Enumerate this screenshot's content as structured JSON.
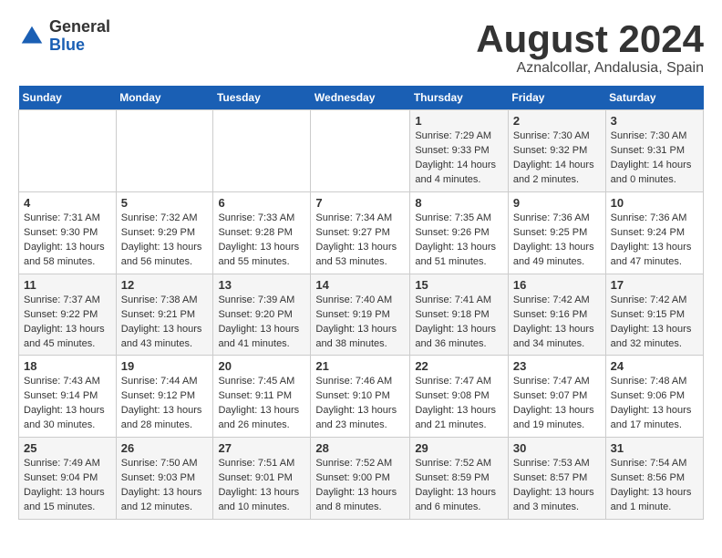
{
  "logo": {
    "general": "General",
    "blue": "Blue"
  },
  "header": {
    "title": "August 2024",
    "subtitle": "Aznalcollar, Andalusia, Spain"
  },
  "weekdays": [
    "Sunday",
    "Monday",
    "Tuesday",
    "Wednesday",
    "Thursday",
    "Friday",
    "Saturday"
  ],
  "weeks": [
    [
      {
        "day": "",
        "detail": ""
      },
      {
        "day": "",
        "detail": ""
      },
      {
        "day": "",
        "detail": ""
      },
      {
        "day": "",
        "detail": ""
      },
      {
        "day": "1",
        "detail": "Sunrise: 7:29 AM\nSunset: 9:33 PM\nDaylight: 14 hours\nand 4 minutes."
      },
      {
        "day": "2",
        "detail": "Sunrise: 7:30 AM\nSunset: 9:32 PM\nDaylight: 14 hours\nand 2 minutes."
      },
      {
        "day": "3",
        "detail": "Sunrise: 7:30 AM\nSunset: 9:31 PM\nDaylight: 14 hours\nand 0 minutes."
      }
    ],
    [
      {
        "day": "4",
        "detail": "Sunrise: 7:31 AM\nSunset: 9:30 PM\nDaylight: 13 hours\nand 58 minutes."
      },
      {
        "day": "5",
        "detail": "Sunrise: 7:32 AM\nSunset: 9:29 PM\nDaylight: 13 hours\nand 56 minutes."
      },
      {
        "day": "6",
        "detail": "Sunrise: 7:33 AM\nSunset: 9:28 PM\nDaylight: 13 hours\nand 55 minutes."
      },
      {
        "day": "7",
        "detail": "Sunrise: 7:34 AM\nSunset: 9:27 PM\nDaylight: 13 hours\nand 53 minutes."
      },
      {
        "day": "8",
        "detail": "Sunrise: 7:35 AM\nSunset: 9:26 PM\nDaylight: 13 hours\nand 51 minutes."
      },
      {
        "day": "9",
        "detail": "Sunrise: 7:36 AM\nSunset: 9:25 PM\nDaylight: 13 hours\nand 49 minutes."
      },
      {
        "day": "10",
        "detail": "Sunrise: 7:36 AM\nSunset: 9:24 PM\nDaylight: 13 hours\nand 47 minutes."
      }
    ],
    [
      {
        "day": "11",
        "detail": "Sunrise: 7:37 AM\nSunset: 9:22 PM\nDaylight: 13 hours\nand 45 minutes."
      },
      {
        "day": "12",
        "detail": "Sunrise: 7:38 AM\nSunset: 9:21 PM\nDaylight: 13 hours\nand 43 minutes."
      },
      {
        "day": "13",
        "detail": "Sunrise: 7:39 AM\nSunset: 9:20 PM\nDaylight: 13 hours\nand 41 minutes."
      },
      {
        "day": "14",
        "detail": "Sunrise: 7:40 AM\nSunset: 9:19 PM\nDaylight: 13 hours\nand 38 minutes."
      },
      {
        "day": "15",
        "detail": "Sunrise: 7:41 AM\nSunset: 9:18 PM\nDaylight: 13 hours\nand 36 minutes."
      },
      {
        "day": "16",
        "detail": "Sunrise: 7:42 AM\nSunset: 9:16 PM\nDaylight: 13 hours\nand 34 minutes."
      },
      {
        "day": "17",
        "detail": "Sunrise: 7:42 AM\nSunset: 9:15 PM\nDaylight: 13 hours\nand 32 minutes."
      }
    ],
    [
      {
        "day": "18",
        "detail": "Sunrise: 7:43 AM\nSunset: 9:14 PM\nDaylight: 13 hours\nand 30 minutes."
      },
      {
        "day": "19",
        "detail": "Sunrise: 7:44 AM\nSunset: 9:12 PM\nDaylight: 13 hours\nand 28 minutes."
      },
      {
        "day": "20",
        "detail": "Sunrise: 7:45 AM\nSunset: 9:11 PM\nDaylight: 13 hours\nand 26 minutes."
      },
      {
        "day": "21",
        "detail": "Sunrise: 7:46 AM\nSunset: 9:10 PM\nDaylight: 13 hours\nand 23 minutes."
      },
      {
        "day": "22",
        "detail": "Sunrise: 7:47 AM\nSunset: 9:08 PM\nDaylight: 13 hours\nand 21 minutes."
      },
      {
        "day": "23",
        "detail": "Sunrise: 7:47 AM\nSunset: 9:07 PM\nDaylight: 13 hours\nand 19 minutes."
      },
      {
        "day": "24",
        "detail": "Sunrise: 7:48 AM\nSunset: 9:06 PM\nDaylight: 13 hours\nand 17 minutes."
      }
    ],
    [
      {
        "day": "25",
        "detail": "Sunrise: 7:49 AM\nSunset: 9:04 PM\nDaylight: 13 hours\nand 15 minutes."
      },
      {
        "day": "26",
        "detail": "Sunrise: 7:50 AM\nSunset: 9:03 PM\nDaylight: 13 hours\nand 12 minutes."
      },
      {
        "day": "27",
        "detail": "Sunrise: 7:51 AM\nSunset: 9:01 PM\nDaylight: 13 hours\nand 10 minutes."
      },
      {
        "day": "28",
        "detail": "Sunrise: 7:52 AM\nSunset: 9:00 PM\nDaylight: 13 hours\nand 8 minutes."
      },
      {
        "day": "29",
        "detail": "Sunrise: 7:52 AM\nSunset: 8:59 PM\nDaylight: 13 hours\nand 6 minutes."
      },
      {
        "day": "30",
        "detail": "Sunrise: 7:53 AM\nSunset: 8:57 PM\nDaylight: 13 hours\nand 3 minutes."
      },
      {
        "day": "31",
        "detail": "Sunrise: 7:54 AM\nSunset: 8:56 PM\nDaylight: 13 hours\nand 1 minute."
      }
    ]
  ]
}
